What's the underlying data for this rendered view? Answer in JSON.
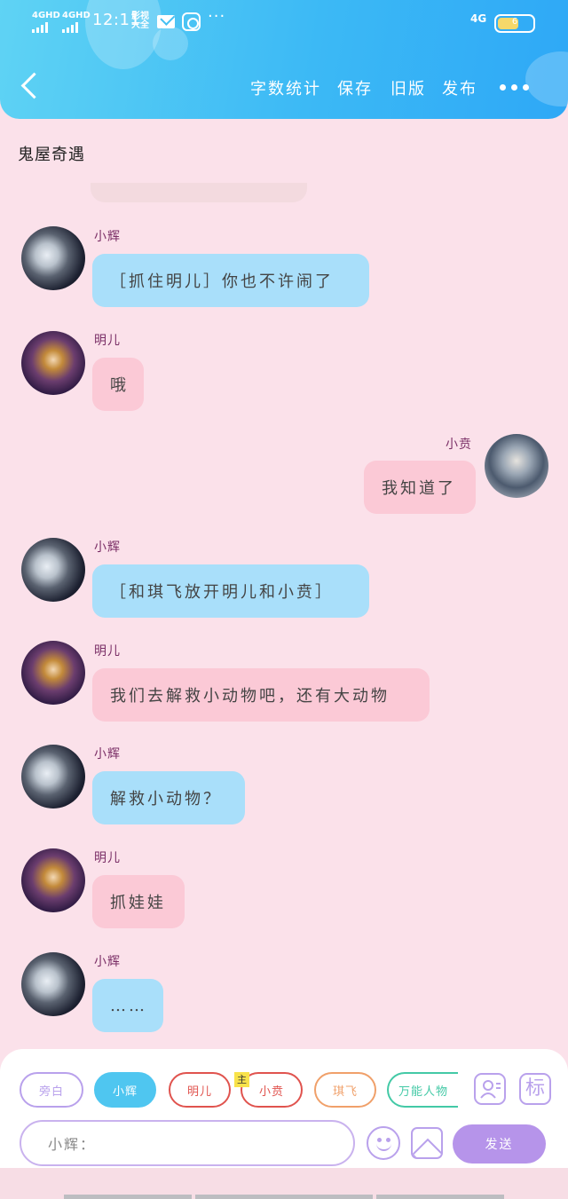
{
  "status_bar": {
    "sim1": "4GHD",
    "sim2": "4GHD",
    "time": "12:11",
    "speed": "影视 大全",
    "more": "···",
    "network": "4G",
    "battery": "6",
    "battery_level": 0.6
  },
  "header": {
    "actions": [
      "字数统计",
      "保存",
      "旧版",
      "发布"
    ]
  },
  "story_title": "鬼屋奇遇",
  "messages": [
    {
      "speaker": "小辉",
      "text": "［抓住明儿］你也不许闹了"
    },
    {
      "speaker": "明儿",
      "text": "哦"
    },
    {
      "speaker": "小贲",
      "text": "我知道了"
    },
    {
      "speaker": "小辉",
      "text": "［和琪飞放开明儿和小贲］"
    },
    {
      "speaker": "明儿",
      "text": "我们去解救小动物吧，还有大动物"
    },
    {
      "speaker": "小辉",
      "text": "解救小动物？"
    },
    {
      "speaker": "明儿",
      "text": "抓娃娃"
    },
    {
      "speaker": "小辉",
      "text": "……"
    }
  ],
  "roles": [
    {
      "label": "旁白",
      "color": "#b9a1ec"
    },
    {
      "label": "小辉",
      "color": "#4fc6f0"
    },
    {
      "label": "明儿",
      "color": "#e0534e"
    },
    {
      "label": "小贲",
      "color": "#e0534e"
    },
    {
      "label": "琪飞",
      "color": "#f0a06a"
    },
    {
      "label": "万能人物",
      "color": "#43c9a6"
    }
  ],
  "main_badge": "主",
  "tag_icon": "标",
  "composer": {
    "input_value": "小辉：",
    "send_label": "发送"
  },
  "colors": {
    "header_blue": "#3cb9f5",
    "page_pink": "#fbe1ea",
    "bubble_blue": "#a9dffa",
    "bubble_pink": "#fbc9d6",
    "accent_purple": "#b694ea"
  },
  "icons": [
    "back-arrow-icon",
    "more-dots-icon",
    "mail-icon",
    "app-icon",
    "battery-icon",
    "role-card-icon",
    "emoji-icon",
    "image-icon"
  ]
}
